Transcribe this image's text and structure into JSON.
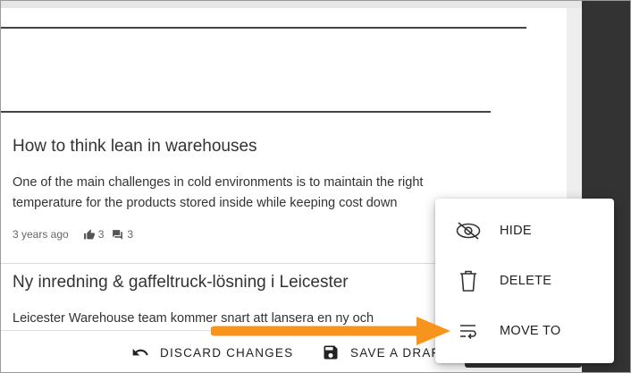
{
  "articles": [
    {
      "title": "How to think lean in warehouses",
      "excerpt": "One of the main challenges in cold environments is to maintain the right temperature for the products stored inside while keeping cost down",
      "age": "3 years ago",
      "likes": "3",
      "comments": "3"
    },
    {
      "title": "Ny inredning & gaffeltruck-lösning i Leicester",
      "excerpt": "Leicester Warehouse team kommer snart att lansera en ny och"
    }
  ],
  "context_menu": {
    "items": [
      {
        "label": "HIDE",
        "icon": "eye-off-icon"
      },
      {
        "label": "DELETE",
        "icon": "trash-icon"
      },
      {
        "label": "MOVE TO",
        "icon": "wrap-text-icon"
      }
    ]
  },
  "action_bar": {
    "discard_label": "DISCARD CHANGES",
    "save_label": "SAVE A DRAFT"
  },
  "colors": {
    "dark_panel": "#333333",
    "arrow": "#f7941d",
    "text": "#333333"
  }
}
